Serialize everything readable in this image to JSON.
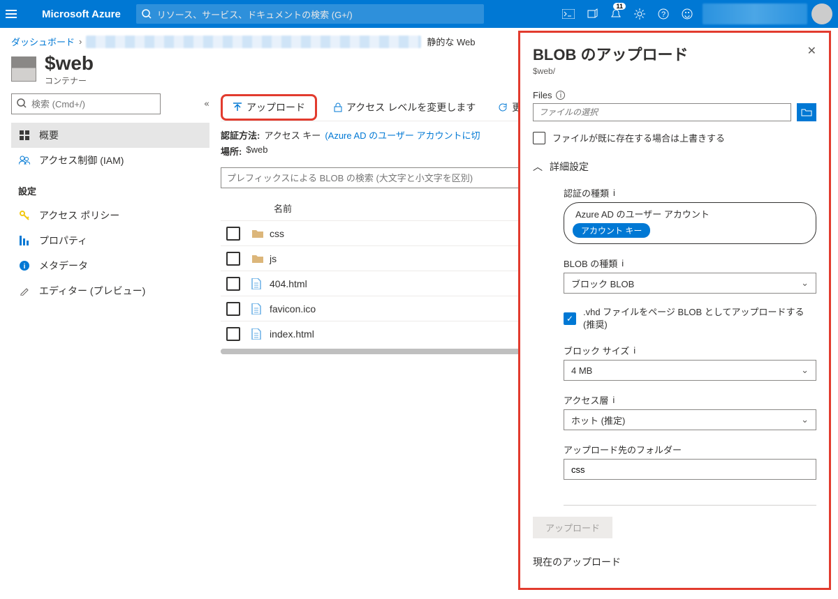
{
  "header": {
    "brand": "Microsoft Azure",
    "search_placeholder": "リソース、サービス、ドキュメントの検索 (G+/)",
    "notif_badge": "11"
  },
  "breadcrumb": {
    "dashboard": "ダッシュボード",
    "tail": "静的な Web"
  },
  "title": {
    "main": "$web",
    "sub": "コンテナー"
  },
  "left": {
    "search_placeholder": "検索 (Cmd+/)",
    "collapse": "«",
    "items": {
      "overview": "概要",
      "iam": "アクセス制御 (IAM)",
      "settings_header": "設定",
      "policy": "アクセス ポリシー",
      "properties": "プロパティ",
      "metadata": "メタデータ",
      "editor": "エディター (プレビュー)"
    }
  },
  "toolbar": {
    "upload": "アップロード",
    "access_level": "アクセス レベルを変更します",
    "refresh": "更"
  },
  "info": {
    "auth_label": "認証方法:",
    "auth_value": "アクセス キー",
    "auth_link": "(Azure AD のユーザー アカウントに切",
    "location_label": "場所:",
    "location_value": "$web"
  },
  "prefix_placeholder": "プレフィックスによる BLOB の検索 (大文字と小文字を区別)",
  "table": {
    "col_name": "名前",
    "rows": [
      {
        "type": "folder",
        "name": "css"
      },
      {
        "type": "folder",
        "name": "js"
      },
      {
        "type": "file",
        "name": "404.html"
      },
      {
        "type": "file",
        "name": "favicon.ico"
      },
      {
        "type": "file",
        "name": "index.html"
      }
    ]
  },
  "panel": {
    "title": "BLOB のアップロード",
    "breadcrumb": "$web/",
    "files_label": "Files",
    "file_input_placeholder": "ファイルの選択",
    "overwrite": "ファイルが既に存在する場合は上書きする",
    "advanced": "詳細設定",
    "auth_type_label": "認証の種類",
    "auth_opt1": "Azure AD のユーザー アカウント",
    "auth_opt2": "アカウント キー",
    "blob_type_label": "BLOB の種類",
    "blob_type_value": "ブロック BLOB",
    "vhd_label": ".vhd ファイルをページ BLOB としてアップロードする (推奨)",
    "block_size_label": "ブロック サイズ",
    "block_size_value": "4 MB",
    "tier_label": "アクセス層",
    "tier_value": "ホット (推定)",
    "folder_label": "アップロード先のフォルダー",
    "folder_value": "css",
    "upload_btn": "アップロード",
    "current_uploads": "現在のアップロード"
  }
}
